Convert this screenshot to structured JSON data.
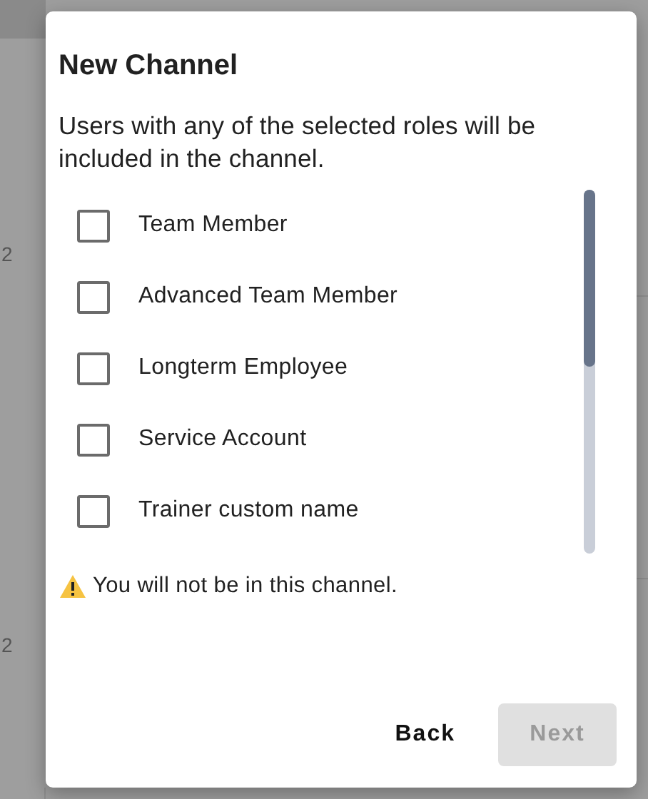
{
  "backdrop": {
    "texts": [
      "2",
      "2"
    ]
  },
  "dialog": {
    "title": "New Channel",
    "description": "Users with any of the selected roles will be included in the channel.",
    "roles": [
      {
        "label": "Team Member",
        "checked": false
      },
      {
        "label": "Advanced Team Member",
        "checked": false
      },
      {
        "label": "Longterm Employee",
        "checked": false
      },
      {
        "label": "Service Account",
        "checked": false
      },
      {
        "label": "Trainer custom name",
        "checked": false
      }
    ],
    "warning": "You will not be in this channel.",
    "buttons": [
      {
        "label": "Back",
        "disabled": false
      },
      {
        "label": "Next",
        "disabled": true
      }
    ]
  }
}
